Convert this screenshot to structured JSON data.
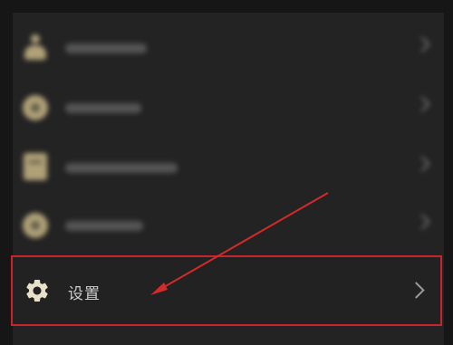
{
  "menu": {
    "settings_label": "设置"
  },
  "colors": {
    "highlight_border": "#c8242b",
    "arrow": "#d32a2a",
    "icon_tint": "#c9b887"
  }
}
